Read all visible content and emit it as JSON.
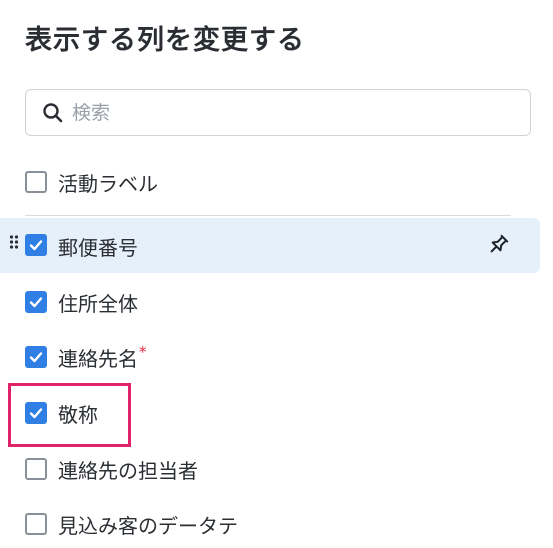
{
  "dialog": {
    "title": "表示する列を変更する"
  },
  "search": {
    "placeholder": "検索",
    "value": ""
  },
  "columns": [
    {
      "label": "活動ラベル",
      "checked": false
    },
    {
      "label": "郵便番号",
      "checked": true,
      "pinned": true,
      "highlighted": true
    },
    {
      "label": "住所全体",
      "checked": true
    },
    {
      "label": "連絡先名",
      "checked": true,
      "required_mark": "*"
    },
    {
      "label": "敬称",
      "checked": true
    },
    {
      "label": "連絡先の担当者",
      "checked": false
    },
    {
      "label": "見込み客のデータテ",
      "checked": false
    }
  ],
  "colors": {
    "checkbox_checked": "#2f7fe4",
    "row_highlight": "#e6f0fb",
    "required": "#e0263a",
    "focus_outline": "#e0226b"
  }
}
